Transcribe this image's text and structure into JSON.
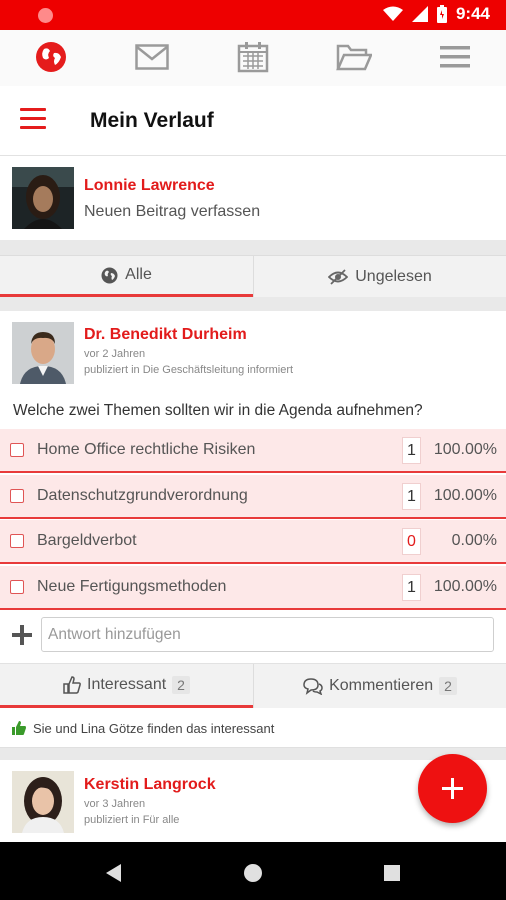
{
  "status_bar": {
    "time": "9:44"
  },
  "top_nav": {
    "items": [
      {
        "icon": "globe-icon"
      },
      {
        "icon": "mail-icon"
      },
      {
        "icon": "calendar-icon"
      },
      {
        "icon": "folder-icon"
      },
      {
        "icon": "menu-icon"
      }
    ]
  },
  "header": {
    "title": "Mein Verlauf"
  },
  "composer": {
    "user_name": "Lonnie Lawrence",
    "prompt": "Neuen Beitrag verfassen"
  },
  "filter_tabs": {
    "all": "Alle",
    "unread": "Ungelesen"
  },
  "post": {
    "author": "Dr. Benedikt Durheim",
    "time": "vor 2 Jahren",
    "published": "publiziert in Die Geschäftsleitung informiert",
    "question": "Welche zwei Themen sollten wir in die Agenda aufnehmen?",
    "poll_options": [
      {
        "label": "Home Office rechtliche Risiken",
        "count": "1",
        "percent": "100.00%"
      },
      {
        "label": "Datenschutzgrundverordnung",
        "count": "1",
        "percent": "100.00%"
      },
      {
        "label": "Bargeldverbot",
        "count": "0",
        "percent": "0.00%"
      },
      {
        "label": "Neue Fertigungsmethoden",
        "count": "1",
        "percent": "100.00%"
      }
    ],
    "answer_placeholder": "Antwort hinzufügen",
    "actions": {
      "interesting_label": "Interessant",
      "interesting_count": "2",
      "comment_label": "Kommentieren",
      "comment_count": "2"
    },
    "likes_text": "Sie und Lina Götze finden das interessant"
  },
  "post2": {
    "author": "Kerstin Langrock",
    "time": "vor 3 Jahren",
    "published": "publiziert in Für alle"
  },
  "colors": {
    "accent": "#ee0000",
    "poll_background": "#fde8e8",
    "like_green": "#3a9a2a"
  }
}
